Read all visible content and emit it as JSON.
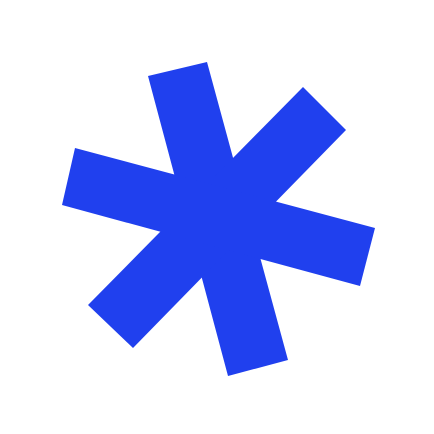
{
  "background_color": "#ffffff",
  "icon": {
    "name": "asterisk-icon",
    "color": "#2040ee"
  }
}
